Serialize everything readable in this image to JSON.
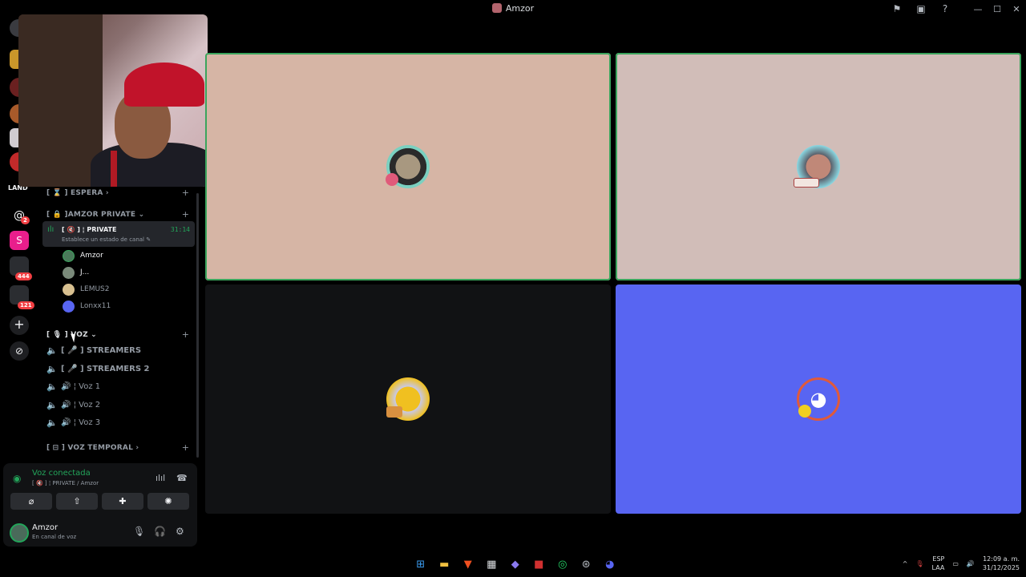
{
  "window": {
    "title": "Amzor"
  },
  "server_badges": {
    "b1": "2",
    "b2": "444",
    "b3": "121"
  },
  "sidebar": {
    "cat_espera": "[ ⌛ ] ESPERA ›",
    "cat_amzor": "[ 🔒 ]AMZOR PRIVATE ⌄",
    "active_channel": {
      "name": "[ 🔇 ] ¦ PRIVATE",
      "time": "31:14",
      "status": "Establece un estado de canal ✎"
    },
    "members": [
      {
        "name": "Amzor"
      },
      {
        "name": "J..."
      },
      {
        "name": "LEMUS2"
      },
      {
        "name": "Lonxx11"
      }
    ],
    "cat_voz": "[ 🎙 ] VOZ ⌄",
    "voice_channels": [
      {
        "label": "[ 🎤 ] STREAMERS"
      },
      {
        "label": "[ 🎤 ] STREAMERS 2"
      },
      {
        "label": "🔊 ¦ Voz 1"
      },
      {
        "label": "🔊 ¦ Voz 2"
      },
      {
        "label": "🔊 ¦ Voz 3"
      }
    ],
    "cat_temporal": "[ ⊟ ] VOZ TEMPORAL ›"
  },
  "voice_panel": {
    "title": "Voz conectada",
    "subtitle": "[ 🔇 ] ¦ PRIVATE / Amzor"
  },
  "user": {
    "name": "Amzor",
    "status": "En canal de voz"
  },
  "taskbar": {
    "lang_top": "ESP",
    "lang_bottom": "LAA",
    "time": "12:09 a. m.",
    "date": "31/12/2025"
  },
  "colors": {
    "tile1": "#d6b5a5",
    "tile2": "#d1bdb8",
    "tile3": "#111214",
    "tile4": "#5865f2",
    "speaking": "#3ba55d",
    "online": "#23a55a"
  }
}
